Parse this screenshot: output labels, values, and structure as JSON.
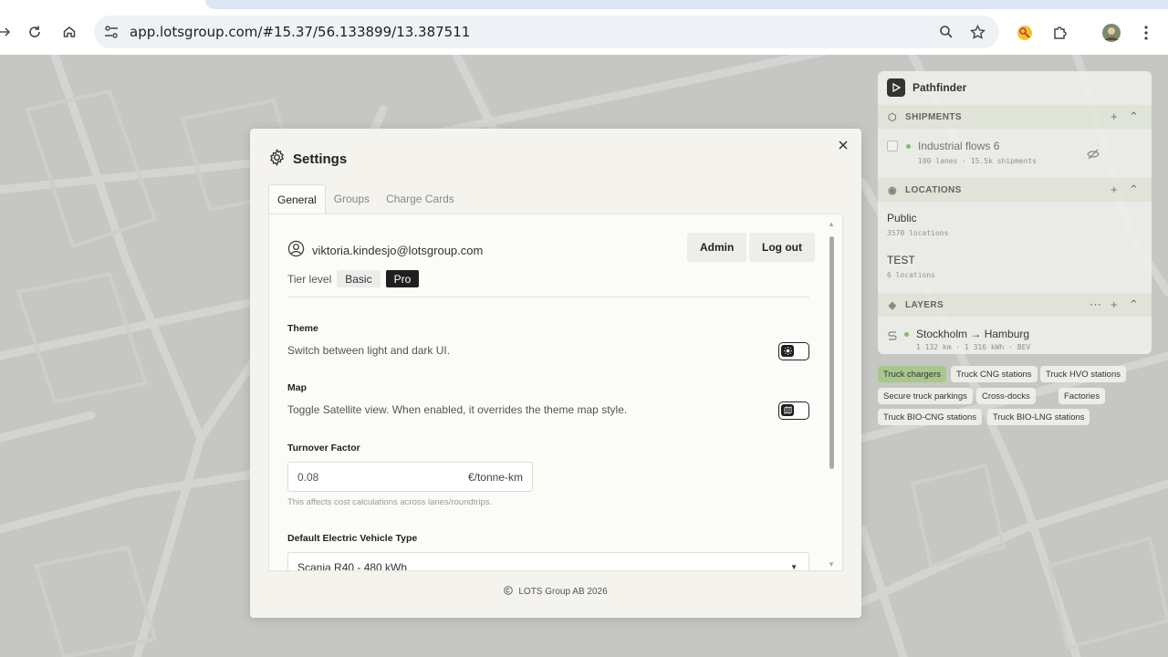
{
  "browser": {
    "url": "app.lotsgroup.com/#15.37/56.133899/13.387511",
    "icons": {
      "forward": "arrow-right-icon",
      "reload": "reload-icon",
      "home": "home-icon",
      "site_settings": "tune-icon",
      "zoom": "zoom-icon",
      "bookmark": "star-icon",
      "extension": "puzzle-icon",
      "profile": "avatar",
      "menu": "kebab-icon"
    }
  },
  "panel": {
    "app_name": "Pathfinder",
    "sections": {
      "shipments": {
        "title": "SHIPMENTS",
        "items": [
          {
            "title": "Industrial flows 6",
            "subtitle": "100 lanes · 15.5k shipments"
          }
        ]
      },
      "locations": {
        "title": "LOCATIONS",
        "items": [
          {
            "title": "Public",
            "subtitle": "3570 locations"
          },
          {
            "title": "TEST",
            "subtitle": "6 locations"
          }
        ]
      },
      "layers": {
        "title": "LAYERS",
        "items": [
          {
            "title": "Stockholm → Hamburg",
            "subtitle": "1 132 km · 1 316 kWh · BEV"
          }
        ]
      }
    },
    "chips": [
      "Truck chargers",
      "Truck CNG stations",
      "Truck HVO stations",
      "Secure truck parkings",
      "Cross-docks",
      "Factories",
      "Truck BIO-CNG stations",
      "Truck BIO-LNG stations"
    ],
    "active_chip": "Truck chargers",
    "accent_color": "#a8c78c"
  },
  "modal": {
    "title": "Settings",
    "tabs": [
      "General",
      "Groups",
      "Charge Cards"
    ],
    "active_tab": "General",
    "email": "viktoria.kindesjo@lotsgroup.com",
    "admin_label": "Admin",
    "logout_label": "Log out",
    "tier_label": "Tier level",
    "tier_options": [
      "Basic",
      "Pro"
    ],
    "tier_selected": "Pro",
    "theme": {
      "label": "Theme",
      "description": "Switch between light and dark UI."
    },
    "map": {
      "label": "Map",
      "description": "Toggle Satellite view. When enabled, it overrides the theme map style."
    },
    "turnover": {
      "label": "Turnover Factor",
      "value": "0.08",
      "unit": "€/tonne-km",
      "hint": "This affects cost calculations across lanes/roundtrips."
    },
    "ev_type": {
      "label": "Default Electric Vehicle Type",
      "value": "Scania R40 - 480 kWh"
    },
    "footer": "LOTS Group AB 2026"
  }
}
